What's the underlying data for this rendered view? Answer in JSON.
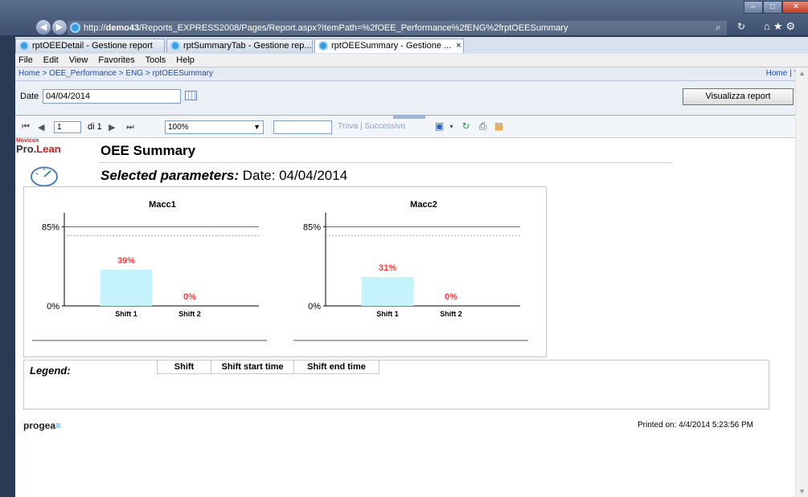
{
  "browser": {
    "address_prefix": "http://",
    "address_host": "demo43",
    "address_path": "/Reports_EXPRESS2008/Pages/Report.aspx?ItemPath=%2fOEE_Performance%2fENG%2frptOEESummary",
    "tabs": [
      {
        "label": "rptOEEDetail - Gestione report"
      },
      {
        "label": "rptSummaryTab - Gestione rep..."
      },
      {
        "label": "rptOEESummary - Gestione ...",
        "close": "×"
      }
    ],
    "menu": [
      "File",
      "Edit",
      "View",
      "Favorites",
      "Tools",
      "Help"
    ]
  },
  "breadcrumb": {
    "path": "Home > OEE_Performance > ENG > rptOEESummary",
    "right": "Home | ?"
  },
  "params": {
    "date_label": "Date",
    "date_value": "04/04/2014",
    "view_button": "Visualizza report"
  },
  "toolbar": {
    "first": "⏮",
    "prev": "◀",
    "page": "1",
    "of": "di 1",
    "next": "▶",
    "last": "⏭",
    "zoom": "100%",
    "find_link": "Trova | Successivo"
  },
  "report": {
    "logo_small": "Movicon",
    "logo_pro": "Pro.",
    "logo_lean": "Lean",
    "title": "OEE Summary",
    "selected_label": "Selected parameters:",
    "selected_value": "Date: 04/04/2014",
    "legend_title": "Legend:",
    "legend_columns": [
      "Shift",
      "Shift start time",
      "Shift end time"
    ],
    "footer_logo": "progea",
    "printed": "Printed on: 4/4/2014 5:23:56 PM"
  },
  "chart_data": [
    {
      "type": "bar",
      "title": "Macc1",
      "categories": [
        "Shift 1",
        "Shift 2"
      ],
      "values": [
        39,
        0
      ],
      "value_labels": [
        "39%",
        "0%"
      ],
      "reference_line": {
        "value": 85,
        "label": "85%"
      },
      "yticks": [
        "85%",
        "0%"
      ],
      "ylim": [
        0,
        100
      ],
      "bar_color": "#c6f3fb",
      "label_color": "#ff3b3b"
    },
    {
      "type": "bar",
      "title": "Macc2",
      "categories": [
        "Shift 1",
        "Shift 2"
      ],
      "values": [
        31,
        0
      ],
      "value_labels": [
        "31%",
        "0%"
      ],
      "reference_line": {
        "value": 85,
        "label": "85%"
      },
      "yticks": [
        "85%",
        "0%"
      ],
      "ylim": [
        0,
        100
      ],
      "bar_color": "#c6f3fb",
      "label_color": "#ff3b3b"
    }
  ]
}
